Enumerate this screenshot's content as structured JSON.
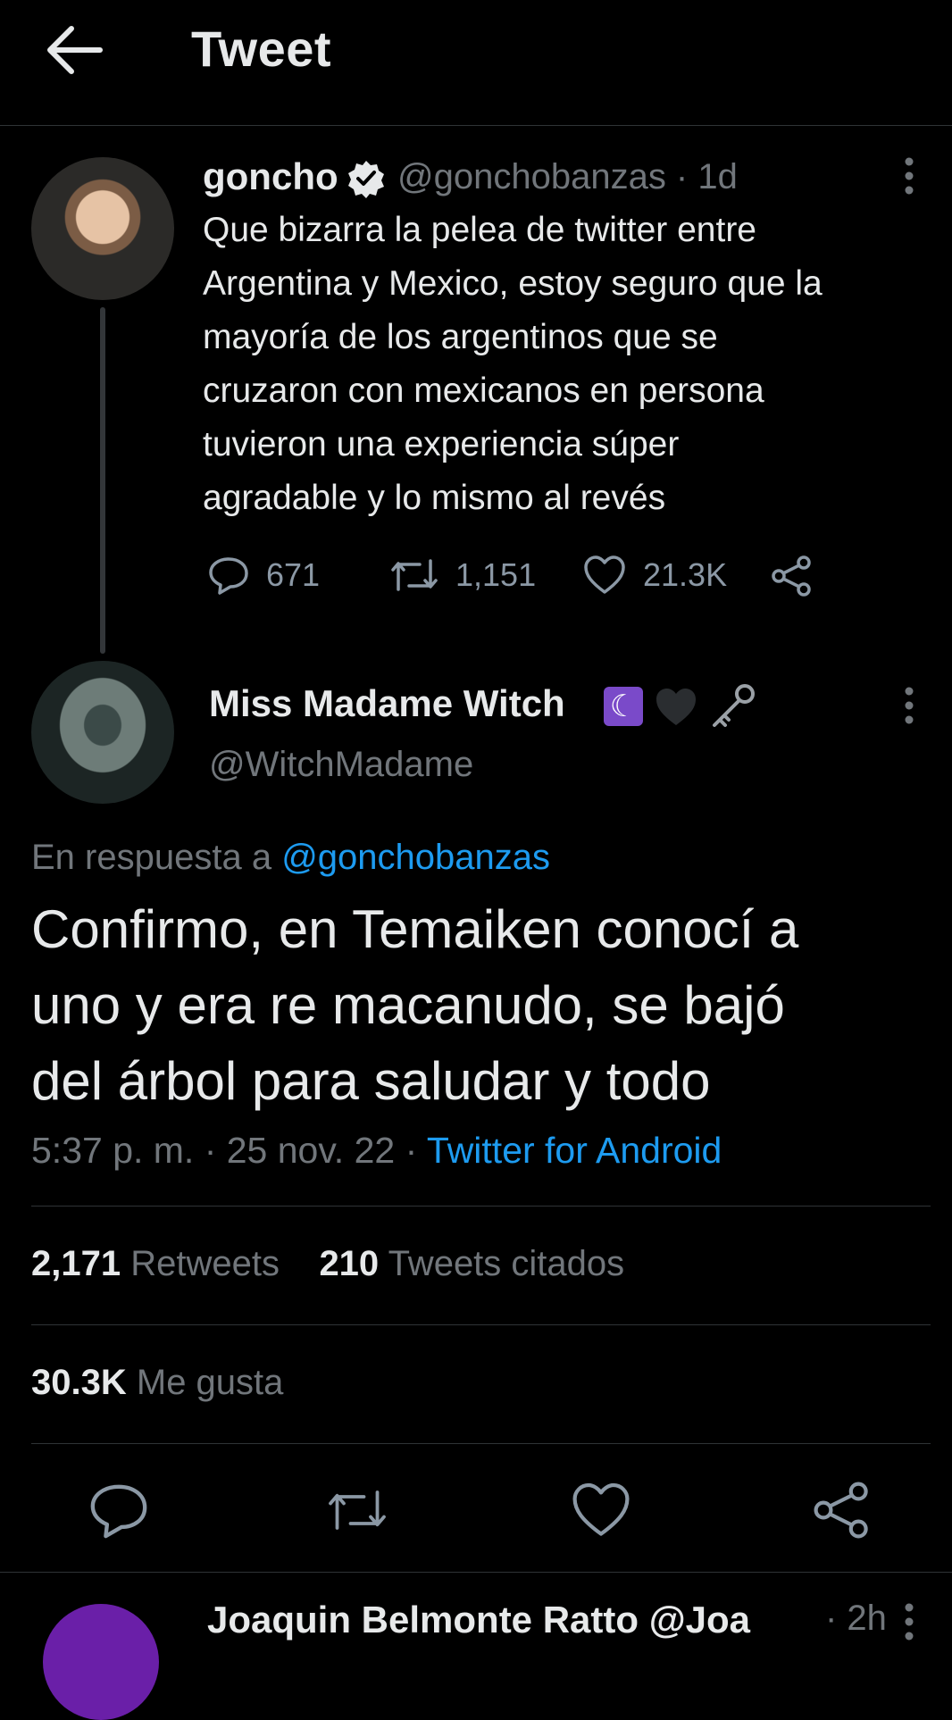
{
  "header": {
    "title": "Tweet"
  },
  "tweet1": {
    "name": "goncho",
    "handle_time": "@gonchobanzas · 1d",
    "text": "Que bizarra la pelea de twitter entre\nArgentina y Mexico, estoy seguro que la\nmayoría de los argentinos que se\ncruzaron con mexicanos en persona\ntuvieron una experiencia súper\nagradable y lo mismo al revés",
    "replies": "671",
    "retweets": "1,151",
    "likes": "21.3K"
  },
  "tweet2": {
    "name": "Miss Madame Witch",
    "name_emojis": [
      "crescent-moon",
      "black-heart",
      "old-key"
    ],
    "handle": "@WitchMadame",
    "reply_prefix": "En respuesta a",
    "reply_handle": "@gonchobanzas",
    "text": "Confirmo, en Temaiken conocí a\nuno y era re macanudo, se bajó\ndel árbol para saludar y todo",
    "meta_time": "5:37 p. m. · 25 nov. 22 · ",
    "meta_source": "Twitter for Android",
    "retweets_count": "2,171",
    "retweets_label": "Retweets",
    "quotes_count": "210",
    "quotes_label": "Tweets citados",
    "likes_count": "30.3K",
    "likes_label": "Me gusta"
  },
  "tweet3": {
    "name_handle": "Joaquin Belmonte Ratto @Joa",
    "time": "· 2h"
  },
  "colors": {
    "background": "#000000",
    "text": "#e7e9ea",
    "secondary": "#71767b",
    "accent": "#1d9bf0",
    "divider": "#2f3336"
  }
}
